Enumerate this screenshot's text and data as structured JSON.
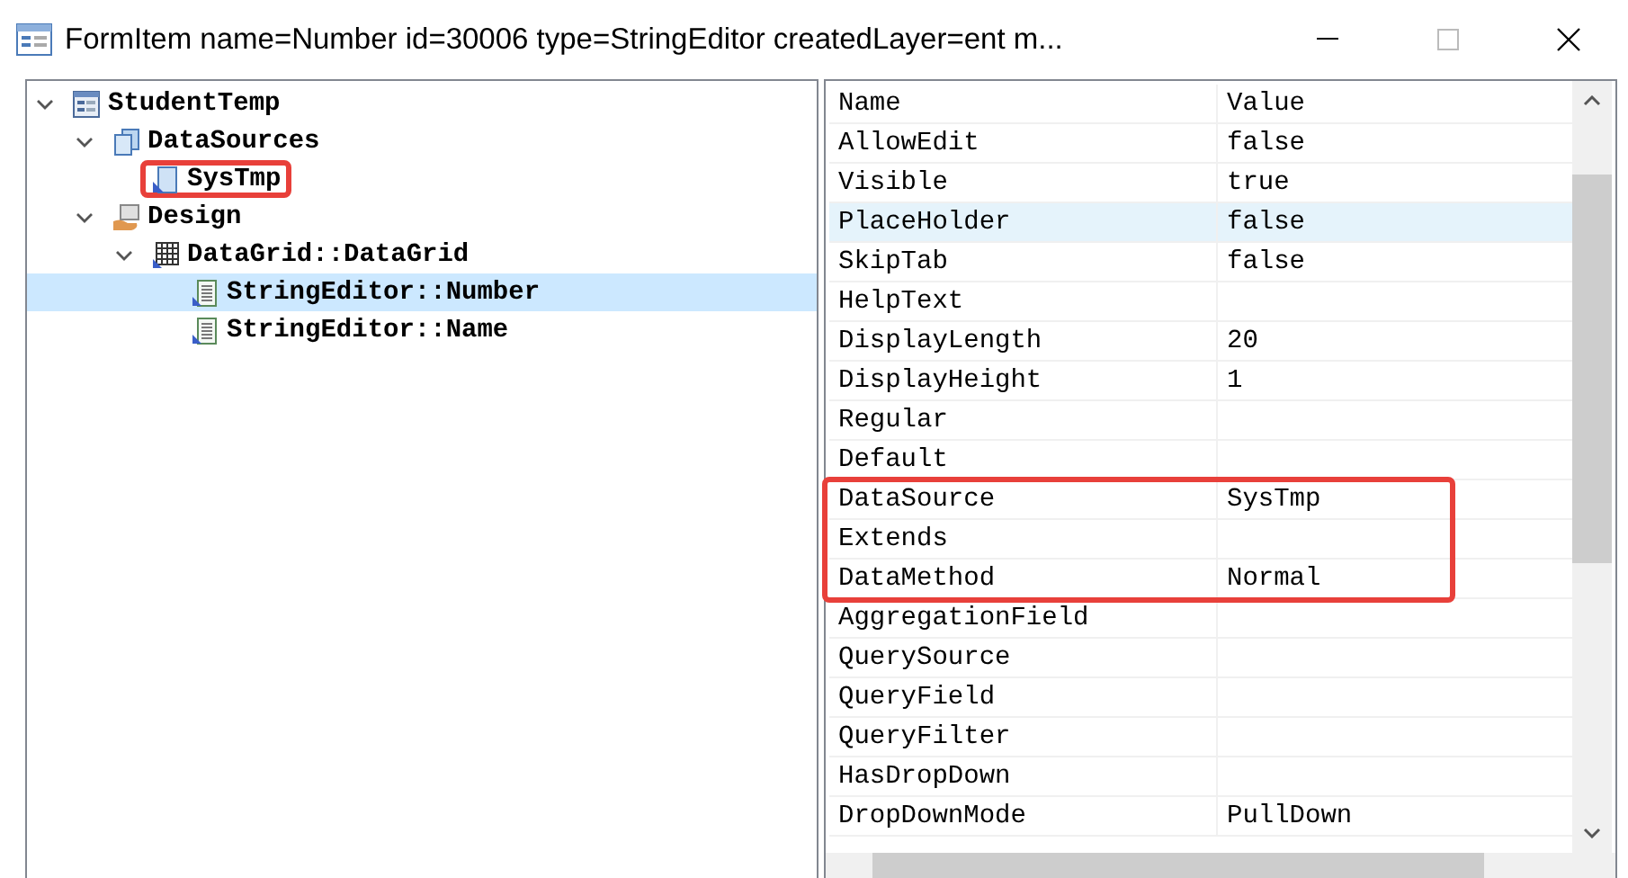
{
  "window": {
    "title": "FormItem name=Number id=30006 type=StringEditor createdLayer=ent m..."
  },
  "tree": [
    {
      "label": "StudentTemp",
      "kind": "form",
      "expanded": true,
      "selected": false,
      "highlighted": false,
      "children": [
        {
          "label": "DataSources",
          "kind": "datasources",
          "expanded": true,
          "selected": false,
          "highlighted": false,
          "children": [
            {
              "label": "SysTmp",
              "kind": "datasource",
              "selected": false,
              "highlighted": true
            }
          ]
        },
        {
          "label": "Design",
          "kind": "design",
          "expanded": true,
          "selected": false,
          "highlighted": false,
          "children": [
            {
              "label": "DataGrid::DataGrid",
              "kind": "grid",
              "expanded": true,
              "selected": false,
              "highlighted": false,
              "children": [
                {
                  "label": "StringEditor::Number",
                  "kind": "editor",
                  "selected": true,
                  "highlighted": false
                },
                {
                  "label": "StringEditor::Name",
                  "kind": "editor",
                  "selected": false,
                  "highlighted": false
                }
              ]
            }
          ]
        }
      ]
    }
  ],
  "properties": {
    "columns": [
      "Name",
      "Value"
    ],
    "rows": [
      {
        "name": "AllowEdit",
        "value": "false",
        "selected": false,
        "highlighted": false
      },
      {
        "name": "Visible",
        "value": "true",
        "selected": false,
        "highlighted": false
      },
      {
        "name": "PlaceHolder",
        "value": "false",
        "selected": true,
        "highlighted": false
      },
      {
        "name": "SkipTab",
        "value": "false",
        "selected": false,
        "highlighted": false
      },
      {
        "name": "HelpText",
        "selected": false,
        "highlighted": false
      },
      {
        "name": "DisplayLength",
        "value": "20",
        "selected": false,
        "highlighted": false
      },
      {
        "name": "DisplayHeight",
        "value": "1",
        "selected": false,
        "highlighted": false
      },
      {
        "name": "Regular",
        "selected": false,
        "highlighted": false
      },
      {
        "name": "Default",
        "selected": false,
        "highlighted": false
      },
      {
        "name": "DataSource",
        "value": "SysTmp",
        "selected": false,
        "highlighted": true
      },
      {
        "name": "Extends",
        "selected": false,
        "highlighted": true
      },
      {
        "name": "DataMethod",
        "value": "Normal",
        "selected": false,
        "highlighted": true
      },
      {
        "name": "AggregationField",
        "selected": false,
        "highlighted": false
      },
      {
        "name": "QuerySource",
        "selected": false,
        "highlighted": false
      },
      {
        "name": "QueryField",
        "selected": false,
        "highlighted": false
      },
      {
        "name": "QueryFilter",
        "selected": false,
        "highlighted": false
      },
      {
        "name": "HasDropDown",
        "selected": false,
        "highlighted": false
      },
      {
        "name": "DropDownMode",
        "value": "PullDown",
        "selected": false,
        "highlighted": false
      }
    ]
  }
}
